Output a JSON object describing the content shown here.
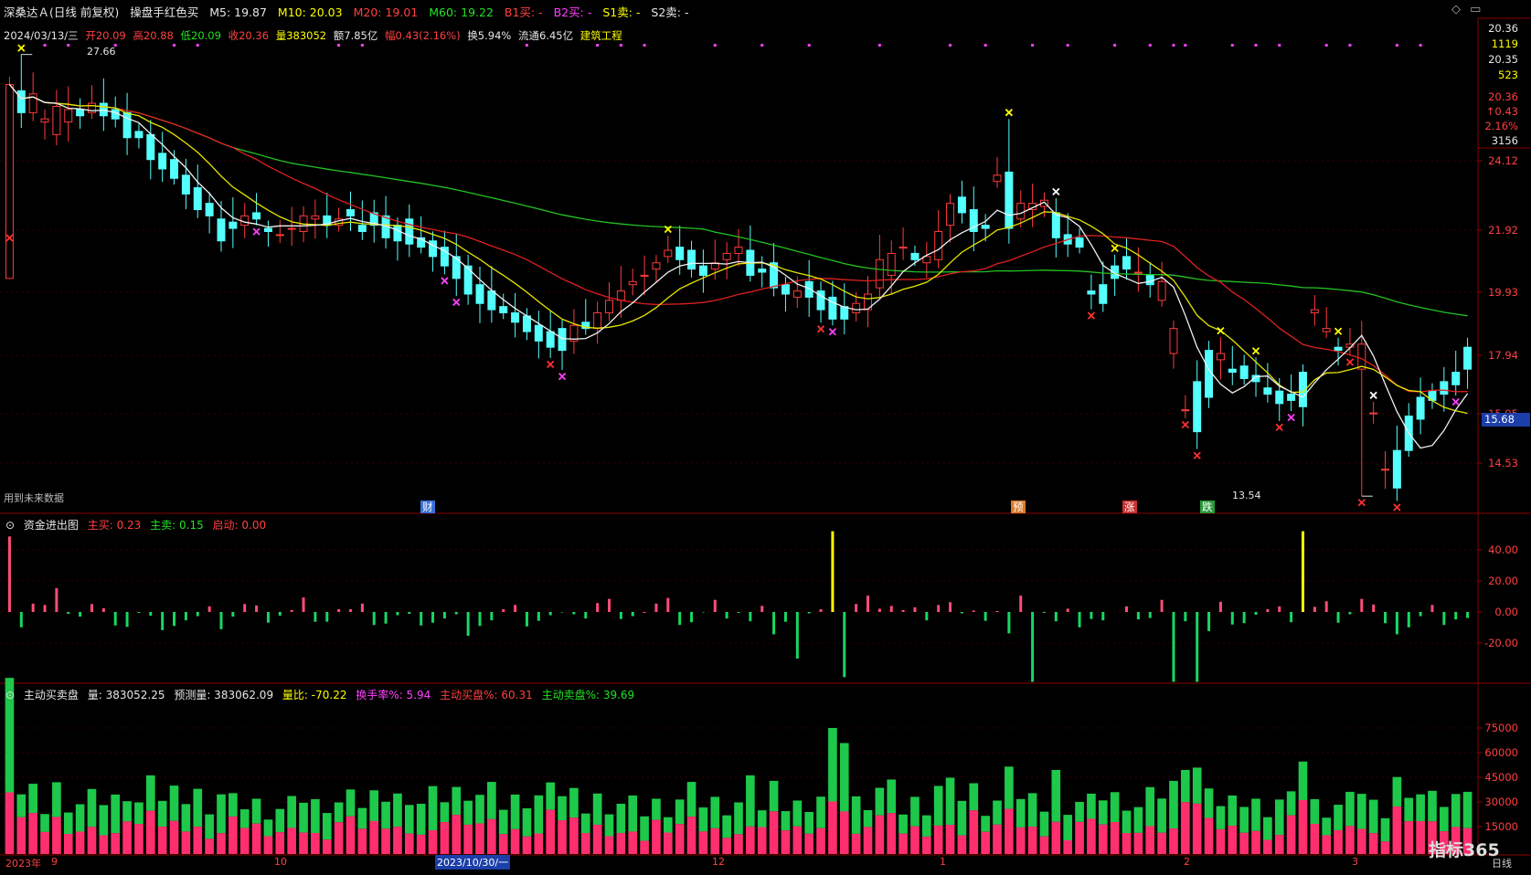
{
  "header": {
    "stock": "深桑达Ａ(日线 前复权)",
    "indicator": "操盘手红色买",
    "ma5": "M5: 19.87",
    "ma10": "M10: 20.03",
    "ma20": "M20: 19.01",
    "ma60": "M60: 19.22",
    "b1": "B1买: -",
    "b2": "B2买: -",
    "s1": "S1卖: -",
    "s2": "S2卖: -"
  },
  "info": {
    "date": "2024/03/13/三",
    "open": "开20.09",
    "high": "高20.88",
    "low": "低20.09",
    "close": "收20.36",
    "volume": "量383052",
    "amount": "额7.85亿",
    "change": "幅0.43(2.16%)",
    "turnover": "换5.94%",
    "float": "流通6.45亿",
    "industry": "建筑工程"
  },
  "main_chart": {
    "annot_high": "27.66",
    "annot_low": "13.54",
    "future_note": "用到未来数据",
    "events": [
      "财",
      "预",
      "涨",
      "跌"
    ],
    "right_quote": [
      "20.36",
      "1119",
      "20.35",
      "523",
      "20.36",
      "↑0.43",
      "2.16%",
      "3156"
    ],
    "price_ticks": [
      "24.12",
      "21.92",
      "19.93",
      "17.94",
      "15.95",
      "14.53"
    ],
    "current_tag": "15.68"
  },
  "money_panel": {
    "title": "资金进出图",
    "buy": "主买: 0.23",
    "sell": "主卖: 0.15",
    "start": "启动: 0.00",
    "ticks": [
      "40.00",
      "20.00",
      "0.00",
      "-20.00"
    ]
  },
  "volume_panel": {
    "title": "主动买卖盘",
    "vol": "量: 383052.25",
    "pred": "预测量: 383062.09",
    "ratio": "量比: -70.22",
    "turnover": "换手率%: 5.94",
    "active_buy": "主动买盘%: 60.31",
    "active_sell": "主动卖盘%: 39.69",
    "ticks": [
      "75000",
      "60000",
      "45000",
      "30000",
      "15000"
    ]
  },
  "time_axis": {
    "labels": [
      "2023年",
      "9",
      "10",
      "2023/10/30/一",
      "12",
      "1",
      "2",
      "3"
    ],
    "period": "日线",
    "brand": "指标365"
  },
  "chart_data": {
    "type": "candlestick",
    "title": "",
    "n": 125,
    "open": [
      20.5,
      26.5,
      25.8,
      25.5,
      25.1,
      25.5,
      25.9,
      25.8,
      26.1,
      25.9,
      25.8,
      25.2,
      25.1,
      24.5,
      24.3,
      23.8,
      23.4,
      22.9,
      22.4,
      22.3,
      22.2,
      22.6,
      22.1,
      21.9,
      22.1,
      22.0,
      22.4,
      22.5,
      22.2,
      22.7,
      22.2,
      22.6,
      22.5,
      22.2,
      22.4,
      21.8,
      21.7,
      21.5,
      21.2,
      20.9,
      20.3,
      20.1,
      19.6,
      19.4,
      19.3,
      19.0,
      18.8,
      18.9,
      18.5,
      19.1,
      18.9,
      19.4,
      19.8,
      20.3,
      20.6,
      20.8,
      21.2,
      21.5,
      21.4,
      20.9,
      20.8,
      21.1,
      21.3,
      21.4,
      20.8,
      21.0,
      20.3,
      19.9,
      20.4,
      20.1,
      19.9,
      19.6,
      19.4,
      19.5,
      20.2,
      20.6,
      21.5,
      21.3,
      21.0,
      21.1,
      22.2,
      23.1,
      22.7,
      22.2,
      23.6,
      23.9,
      22.4,
      22.7,
      22.8,
      22.6,
      21.9,
      21.8,
      20.1,
      20.3,
      20.9,
      21.2,
      20.7,
      20.6,
      19.8,
      18.1,
      16.3,
      17.2,
      18.2,
      17.9,
      17.6,
      17.7,
      17.4,
      17.0,
      16.9,
      16.8,
      17.5,
      19.4,
      18.8,
      18.3,
      18.3,
      17.6,
      16.2,
      14.4,
      15.0,
      16.1,
      16.7,
      16.9,
      17.2,
      17.5,
      18.3
    ],
    "close": [
      26.7,
      25.8,
      26.4,
      25.6,
      26.0,
      25.9,
      25.7,
      26.1,
      25.7,
      25.6,
      25.0,
      25.0,
      24.3,
      24.0,
      23.7,
      23.2,
      22.7,
      22.5,
      21.7,
      22.1,
      22.5,
      22.4,
      22.0,
      21.9,
      22.1,
      22.5,
      22.5,
      22.2,
      22.4,
      22.5,
      22.0,
      22.2,
      21.8,
      21.7,
      21.6,
      21.5,
      21.2,
      20.9,
      20.5,
      20.0,
      19.7,
      19.5,
      19.4,
      19.1,
      18.8,
      18.5,
      18.3,
      18.2,
      19.0,
      18.9,
      19.4,
      19.8,
      20.1,
      20.4,
      20.6,
      21.0,
      21.4,
      21.1,
      20.8,
      20.6,
      21.0,
      21.3,
      21.5,
      20.6,
      20.7,
      20.2,
      20.0,
      20.1,
      19.9,
      19.5,
      19.2,
      19.2,
      19.7,
      20.0,
      21.1,
      21.3,
      21.5,
      21.1,
      21.2,
      22.0,
      22.9,
      22.6,
      22.0,
      22.1,
      23.8,
      22.1,
      22.9,
      22.9,
      23.0,
      21.8,
      21.6,
      21.5,
      20.0,
      19.7,
      20.5,
      20.8,
      20.7,
      20.3,
      20.4,
      18.9,
      16.3,
      15.6,
      16.7,
      18.1,
      17.5,
      17.3,
      17.2,
      16.8,
      16.5,
      16.6,
      16.4,
      19.5,
      18.9,
      18.2,
      18.4,
      18.4,
      16.2,
      14.4,
      13.8,
      15.0,
      16.0,
      16.6,
      16.8,
      17.1,
      17.6,
      18.1
    ]
  }
}
